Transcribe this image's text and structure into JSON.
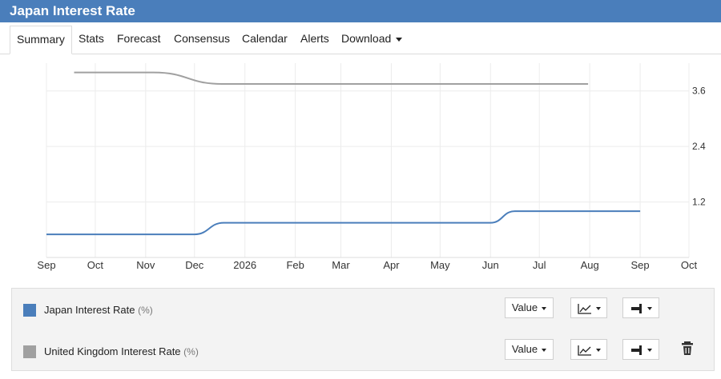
{
  "page": {
    "title": "Japan Interest Rate"
  },
  "tabs": [
    {
      "label": "Summary",
      "active": true
    },
    {
      "label": "Stats"
    },
    {
      "label": "Forecast"
    },
    {
      "label": "Consensus"
    },
    {
      "label": "Calendar"
    },
    {
      "label": "Alerts"
    },
    {
      "label": "Download",
      "dropdown": true
    }
  ],
  "chart_data": {
    "type": "line",
    "x_ticks": [
      "Sep",
      "Oct",
      "Nov",
      "Dec",
      "2026",
      "Feb",
      "Mar",
      "Apr",
      "May",
      "Jun",
      "Jul",
      "Aug",
      "Sep",
      "Oct"
    ],
    "y_ticks": [
      "1.2",
      "2.4",
      "3.6"
    ],
    "ylim": [
      0,
      4.2
    ],
    "grid": true,
    "series": [
      {
        "name": "Japan Interest Rate",
        "color": "#4a7ebb",
        "points": [
          [
            "2025-09-01",
            0.5
          ],
          [
            "2025-12-01",
            0.5
          ],
          [
            "2025-12-19",
            0.75
          ],
          [
            "2026-06-01",
            0.75
          ],
          [
            "2026-06-16",
            1.0
          ],
          [
            "2026-09-01",
            1.0
          ]
        ]
      },
      {
        "name": "United Kingdom Interest Rate",
        "color": "#a0a0a0",
        "points": [
          [
            "2025-09-18",
            4.0
          ],
          [
            "2025-11-06",
            4.0
          ],
          [
            "2025-12-18",
            3.75
          ],
          [
            "2026-07-31",
            3.75
          ]
        ]
      }
    ]
  },
  "legend": [
    {
      "label": "Japan Interest Rate",
      "unit": "(%)",
      "color": "#4a7ebb",
      "value_label": "Value"
    },
    {
      "label": "United Kingdom Interest Rate",
      "unit": "(%)",
      "color": "#a0a0a0",
      "value_label": "Value",
      "delete_icon": "trash-icon"
    }
  ]
}
